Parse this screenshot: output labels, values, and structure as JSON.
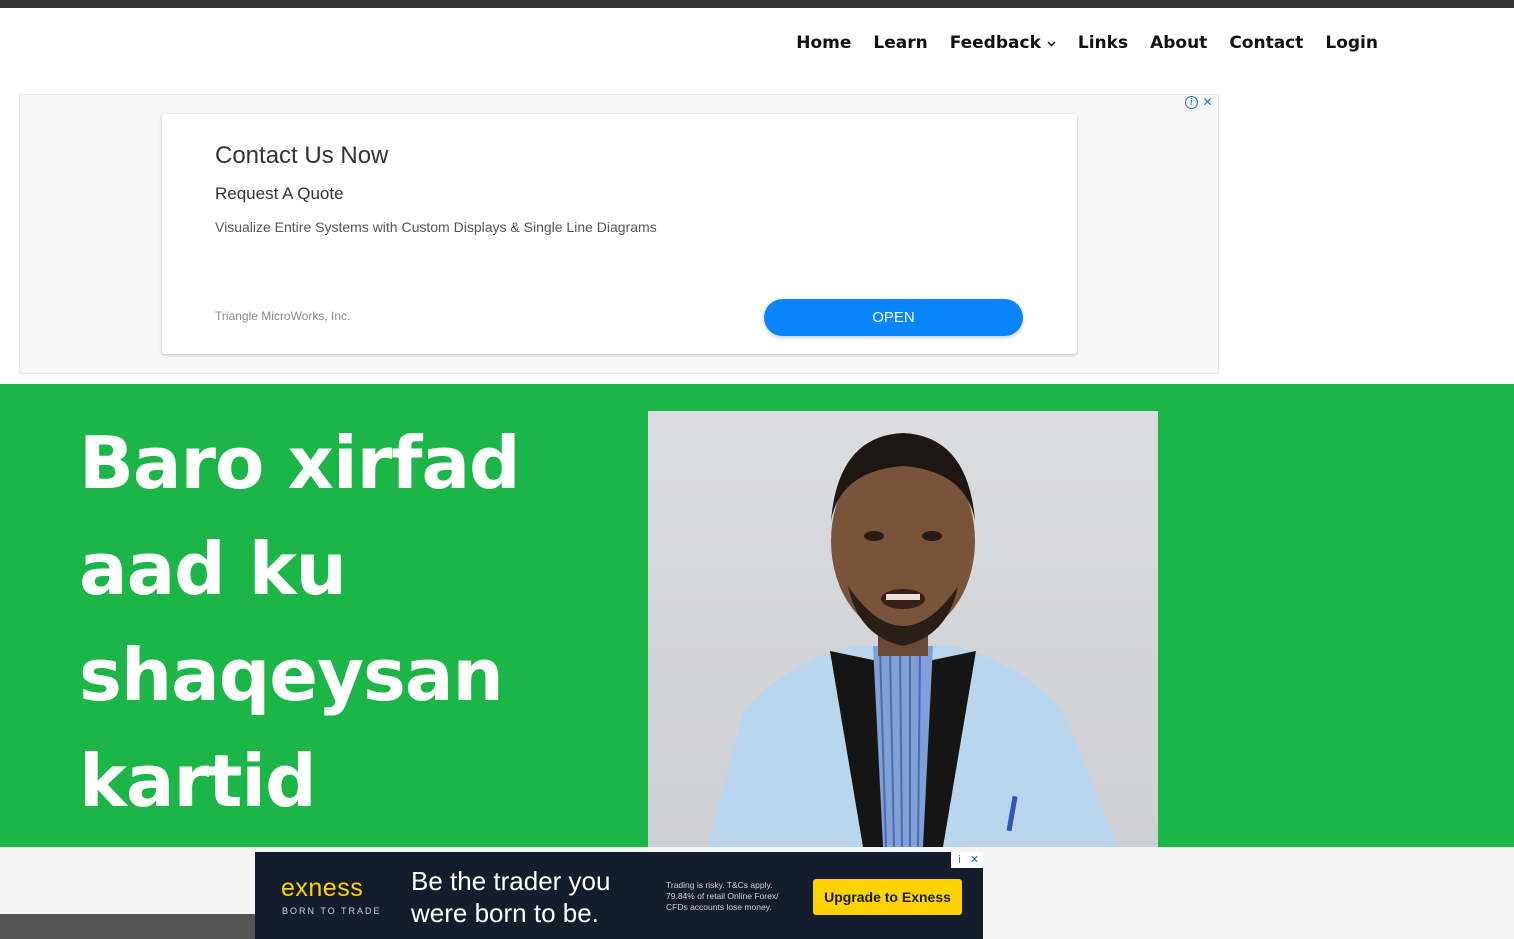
{
  "nav": {
    "items": [
      "Home",
      "Learn",
      "Feedback",
      "Links",
      "About",
      "Contact",
      "Login"
    ]
  },
  "ad_top": {
    "title": "Contact Us Now",
    "subtitle": "Request A Quote",
    "description": "Visualize Entire Systems with Custom Displays & Single Line Diagrams",
    "advertiser": "Triangle MicroWorks, Inc.",
    "button": "OPEN",
    "info_glyph": "i",
    "close_glyph": "✕"
  },
  "hero": {
    "title": "Baro xirfad aad ku shaqeysan kartid",
    "bg_color": "#1bb548"
  },
  "ad_bottom": {
    "logo": "exness",
    "tagline": "BORN TO TRADE",
    "headline": "Be the trader you were born to be.",
    "disclaimer": "Trading is risky. T&Cs apply. 79.84% of retail Online Forex/ CFDs accounts lose money.",
    "button": "Upgrade to Exness",
    "info_glyph": "i",
    "close_glyph": "✕"
  }
}
